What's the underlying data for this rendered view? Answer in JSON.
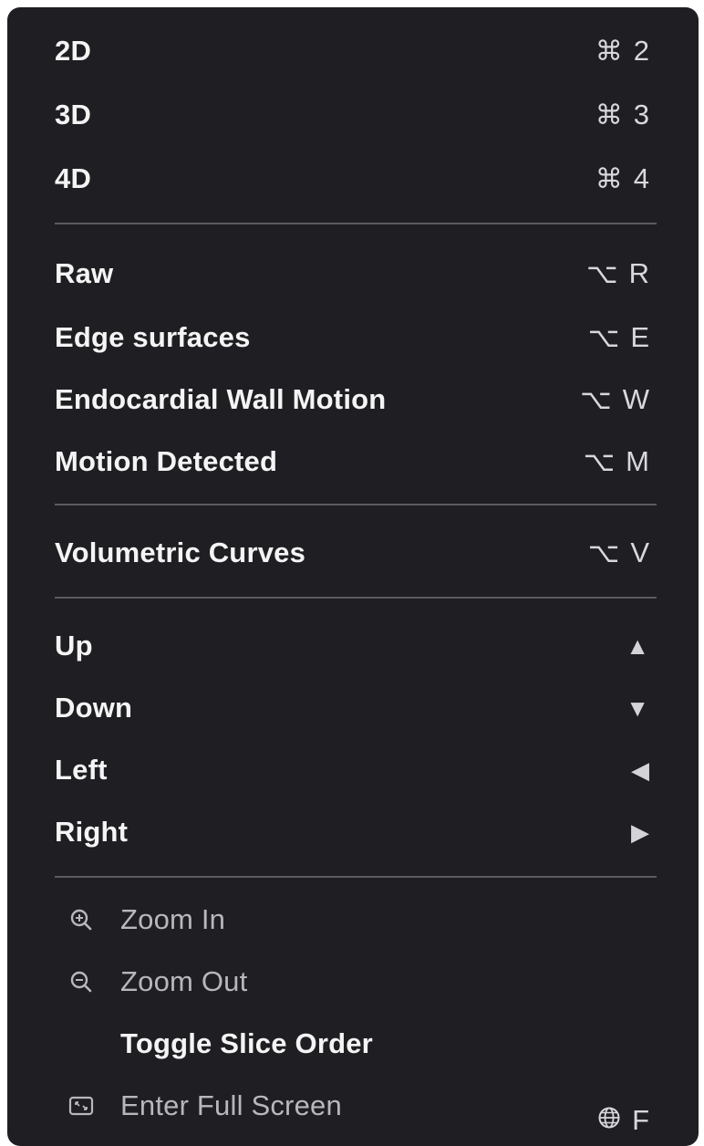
{
  "menu": {
    "view_items": [
      {
        "label": "2D",
        "modifier": "⌘",
        "key": "2"
      },
      {
        "label": "3D",
        "modifier": "⌘",
        "key": "3"
      },
      {
        "label": "4D",
        "modifier": "⌘",
        "key": "4"
      }
    ],
    "render_items": [
      {
        "label": "Raw",
        "modifier": "⌥",
        "key": "R"
      },
      {
        "label": "Edge surfaces",
        "modifier": "⌥",
        "key": "E"
      },
      {
        "label": "Endocardial Wall Motion",
        "modifier": "⌥",
        "key": "W"
      },
      {
        "label": "Motion Detected",
        "modifier": "⌥",
        "key": "M"
      }
    ],
    "curves_item": {
      "label": "Volumetric Curves",
      "modifier": "⌥",
      "key": "V"
    },
    "nav_items": [
      {
        "label": "Up",
        "arrow": "▲",
        "icon": "arrow-up-icon"
      },
      {
        "label": "Down",
        "arrow": "▼",
        "icon": "arrow-down-icon"
      },
      {
        "label": "Left",
        "arrow": "◀",
        "icon": "arrow-left-icon"
      },
      {
        "label": "Right",
        "arrow": "▶",
        "icon": "arrow-right-icon"
      }
    ],
    "zoom_in": {
      "label": "Zoom In",
      "icon": "zoom-in-icon"
    },
    "zoom_out": {
      "label": "Zoom Out",
      "icon": "zoom-out-icon"
    },
    "toggle_slice": {
      "label": "Toggle Slice Order"
    },
    "full_screen": {
      "label": "Enter Full Screen",
      "icon": "fullscreen-icon",
      "shortcut_icon": "globe-icon",
      "key": "F"
    }
  },
  "colors": {
    "background": "#1f1e22",
    "text": "#f4f4f4",
    "dim_text": "#b8b8bc",
    "separator": "#5c5c60"
  }
}
